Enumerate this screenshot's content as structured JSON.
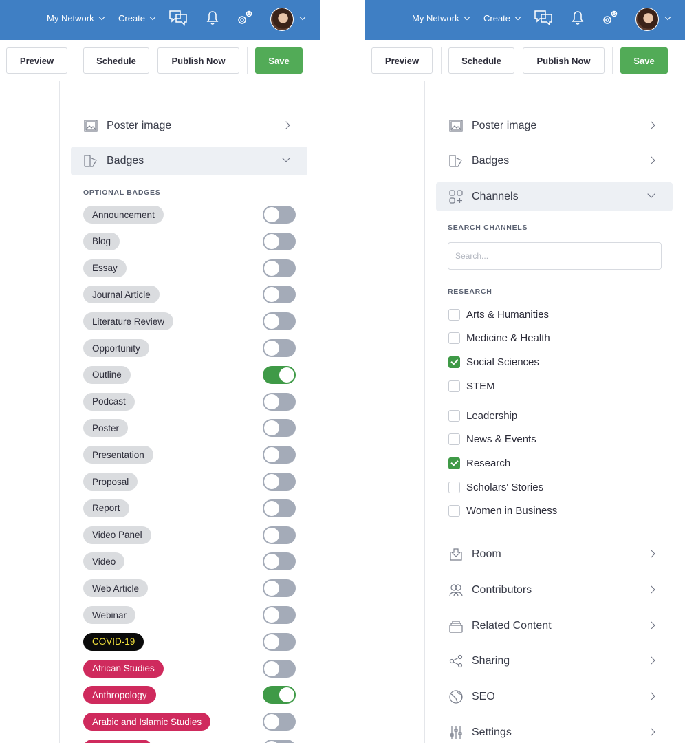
{
  "colors": {
    "header_bg": "#3f7fc4",
    "save_bg": "#52ab57",
    "toggle_on": "#3f9a47",
    "toggle_off": "#a4abb8",
    "badge_gray": "#dadcdf",
    "badge_black": "#0a0a0a",
    "badge_black_text": "#f2e13c",
    "badge_red": "#cf2a5d"
  },
  "header": {
    "my_network": "My Network",
    "create": "Create",
    "icons": [
      "chat-icon",
      "bell-icon",
      "settings-gears-icon",
      "avatar"
    ]
  },
  "toolbar": {
    "preview": "Preview",
    "schedule": "Schedule",
    "publish": "Publish Now",
    "save": "Save"
  },
  "left": {
    "sections": [
      {
        "label": "Poster image",
        "icon": "image-icon",
        "expanded": false
      },
      {
        "label": "Badges",
        "icon": "badge-icon",
        "expanded": true
      }
    ],
    "optional_heading": "OPTIONAL BADGES",
    "badges": [
      {
        "label": "Announcement",
        "style": "gray",
        "on": false
      },
      {
        "label": "Blog",
        "style": "gray",
        "on": false
      },
      {
        "label": "Essay",
        "style": "gray",
        "on": false
      },
      {
        "label": "Journal Article",
        "style": "gray",
        "on": false
      },
      {
        "label": "Literature Review",
        "style": "gray",
        "on": false
      },
      {
        "label": "Opportunity",
        "style": "gray",
        "on": false
      },
      {
        "label": "Outline",
        "style": "gray",
        "on": true
      },
      {
        "label": "Podcast",
        "style": "gray",
        "on": false
      },
      {
        "label": "Poster",
        "style": "gray",
        "on": false
      },
      {
        "label": "Presentation",
        "style": "gray",
        "on": false
      },
      {
        "label": "Proposal",
        "style": "gray",
        "on": false
      },
      {
        "label": "Report",
        "style": "gray",
        "on": false
      },
      {
        "label": "Video Panel",
        "style": "gray",
        "on": false
      },
      {
        "label": "Video",
        "style": "gray",
        "on": false
      },
      {
        "label": "Web Article",
        "style": "gray",
        "on": false
      },
      {
        "label": "Webinar",
        "style": "gray",
        "on": false
      },
      {
        "label": "COVID-19",
        "style": "black",
        "on": false
      },
      {
        "label": "African Studies",
        "style": "red",
        "on": false
      },
      {
        "label": "Anthropology",
        "style": "red",
        "on": true
      },
      {
        "label": "Arabic and Islamic Studies",
        "style": "red",
        "on": false
      }
    ]
  },
  "right": {
    "sections_top": [
      {
        "label": "Poster image",
        "icon": "image-icon",
        "expanded": false
      },
      {
        "label": "Badges",
        "icon": "badge-icon",
        "expanded": false
      },
      {
        "label": "Channels",
        "icon": "channels-grid-icon",
        "expanded": true
      }
    ],
    "search_heading": "SEARCH CHANNELS",
    "search_placeholder": "Search...",
    "research_heading": "RESEARCH",
    "research_channels": [
      {
        "label": "Arts & Humanities",
        "checked": false
      },
      {
        "label": "Medicine & Health",
        "checked": false
      },
      {
        "label": "Social Sciences",
        "checked": true
      },
      {
        "label": "STEM",
        "checked": false
      }
    ],
    "other_channels": [
      {
        "label": "Leadership",
        "checked": false
      },
      {
        "label": "News & Events",
        "checked": false
      },
      {
        "label": "Research",
        "checked": true
      },
      {
        "label": "Scholars' Stories",
        "checked": false
      },
      {
        "label": "Women in Business",
        "checked": false
      }
    ],
    "sections_bottom": [
      {
        "label": "Room",
        "icon": "room-download-icon"
      },
      {
        "label": "Contributors",
        "icon": "contributors-icon"
      },
      {
        "label": "Related Content",
        "icon": "related-content-icon"
      },
      {
        "label": "Sharing",
        "icon": "share-icon"
      },
      {
        "label": "SEO",
        "icon": "globe-icon"
      },
      {
        "label": "Settings",
        "icon": "sliders-icon"
      }
    ]
  }
}
